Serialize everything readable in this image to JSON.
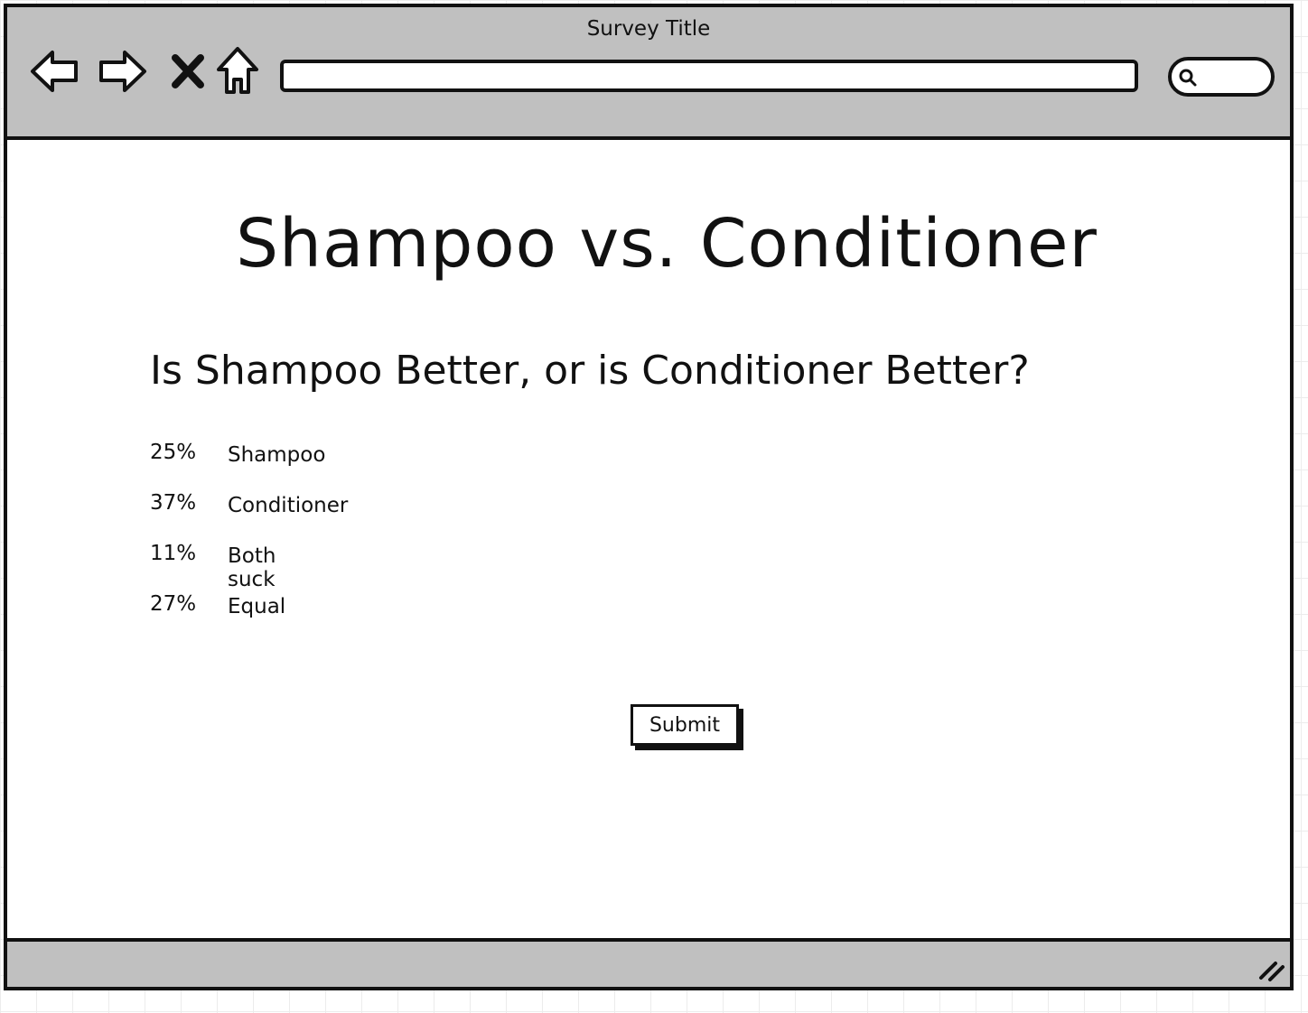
{
  "window": {
    "title": "Survey Title"
  },
  "toolbar": {
    "back_icon": "back-arrow-icon",
    "forward_icon": "forward-arrow-icon",
    "stop_icon": "close-x-icon",
    "home_icon": "home-icon",
    "address_value": "",
    "search_value": "",
    "search_icon": "search-icon"
  },
  "page": {
    "title": "Shampoo vs. Conditioner",
    "question": "Is Shampoo Better, or is Conditioner Better?",
    "results": [
      {
        "percent": "25%",
        "label": "Shampoo"
      },
      {
        "percent": "37%",
        "label": "Conditioner"
      },
      {
        "percent": "11%",
        "label": "Both suck"
      },
      {
        "percent": "27%",
        "label": "Equal"
      }
    ],
    "submit_label": "Submit"
  },
  "colors": {
    "chrome": "#c0c0c0",
    "ink": "#111111",
    "background": "#ffffff"
  }
}
